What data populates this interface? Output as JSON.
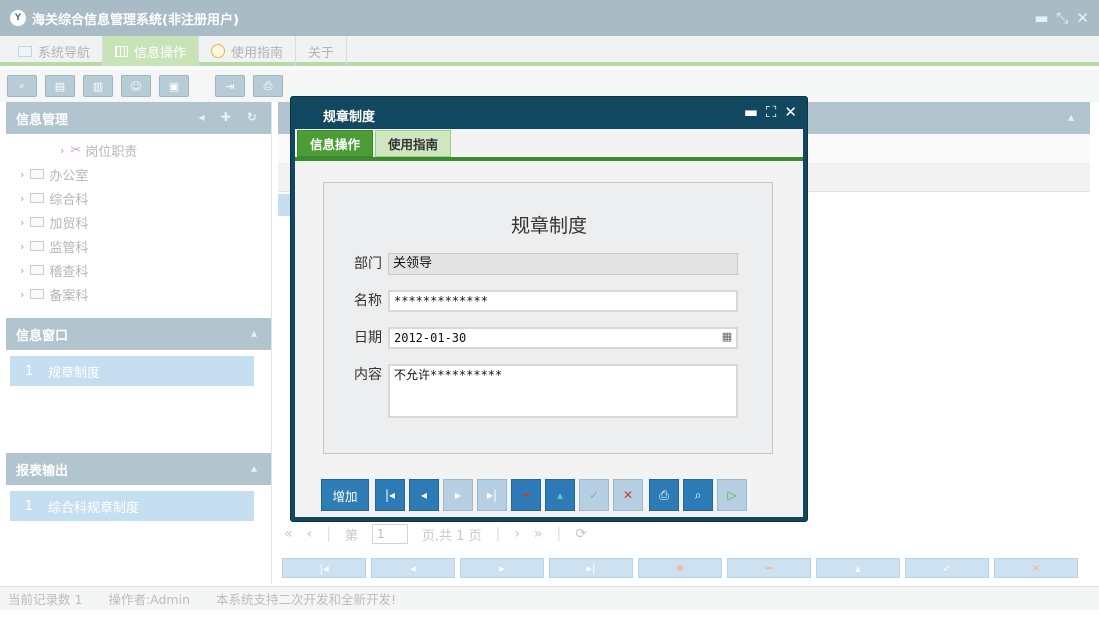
{
  "app": {
    "title": "海关综合信息管理系统(非注册用户)",
    "logo_text": "Y"
  },
  "window_controls": {
    "minimize": "▬",
    "restore": "⤡",
    "close": "✕"
  },
  "menu": {
    "tabs": [
      {
        "label": "系统导航",
        "icon": "monitor-icon"
      },
      {
        "label": "信息操作",
        "icon": "grid-icon"
      },
      {
        "label": "使用指南",
        "icon": "clock-icon"
      },
      {
        "label": "关于",
        "icon": ""
      }
    ]
  },
  "left": {
    "info_mgmt": {
      "title": "信息管理",
      "tree": [
        "岗位职责",
        "办公室",
        "综合科",
        "加贸科",
        "监管科",
        "稽查科",
        "备案科"
      ]
    },
    "info_window": {
      "title": "信息窗口",
      "items": [
        {
          "num": "1",
          "label": "规章制度"
        }
      ]
    },
    "report": {
      "title": "报表输出",
      "items": [
        {
          "num": "1",
          "label": "综合科规章制度"
        }
      ]
    }
  },
  "pager": {
    "first": "«",
    "prev": "‹",
    "page_label": "第",
    "page": "1",
    "of_label": "页,共 1 页",
    "next": "›",
    "last": "»",
    "refresh": "⟳"
  },
  "status": {
    "records": "当前记录数 1",
    "operator": "操作者:Admin",
    "notice": "本系统支持二次开发和全新开发!"
  },
  "modal": {
    "title": "规章制度",
    "tabs": [
      "信息操作",
      "使用指南"
    ],
    "form": {
      "heading": "规章制度",
      "dept_label": "部门",
      "dept_value": "关领导",
      "name_label": "名称",
      "name_value": "*************",
      "date_label": "日期",
      "date_value": "2012-01-30",
      "content_label": "内容",
      "content_value": "不允许**********"
    },
    "buttons": {
      "add": "增加"
    }
  },
  "colors": {
    "titlebar": "#a9bcc6",
    "modal": "#12485f",
    "active_tab": "#4c9d36",
    "selection": "#c5def0"
  }
}
